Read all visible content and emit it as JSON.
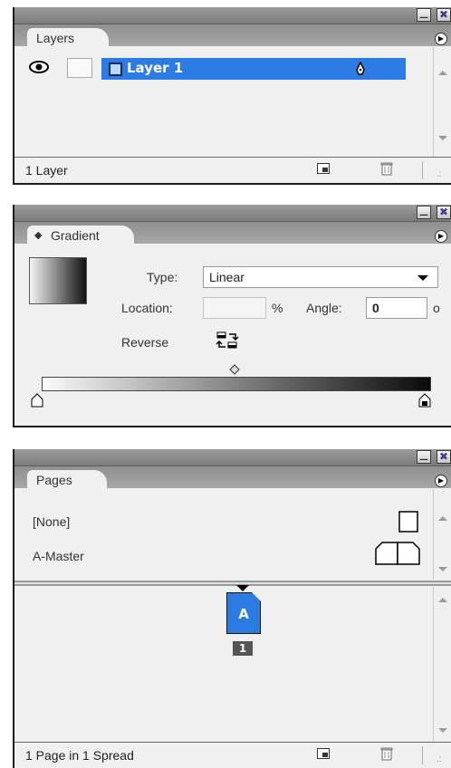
{
  "layers_panel": {
    "tab_label": "Layers",
    "layer_name": "Layer 1",
    "layer_color": "#2c7be2",
    "status_text": "1 Layer",
    "icons": [
      "eye-icon",
      "pen-icon",
      "new-layer-icon",
      "trash-icon",
      "flyout-menu-icon",
      "minimize-icon",
      "close-icon"
    ]
  },
  "gradient_panel": {
    "tab_label": "Gradient",
    "type_label": "Type:",
    "type_value": "Linear",
    "location_label": "Location:",
    "location_value": "",
    "percent_symbol": "%",
    "angle_label": "Angle:",
    "angle_value": "0",
    "degree_symbol": "o",
    "reverse_label": "Reverse",
    "ramp_start_color": "#fafafa",
    "ramp_end_color": "#0a0a0a"
  },
  "pages_panel": {
    "tab_label": "Pages",
    "masters": [
      "[None]",
      "A-Master"
    ],
    "page_letter": "A",
    "page_number": "1",
    "status_text": "1 Page in 1 Spread"
  }
}
